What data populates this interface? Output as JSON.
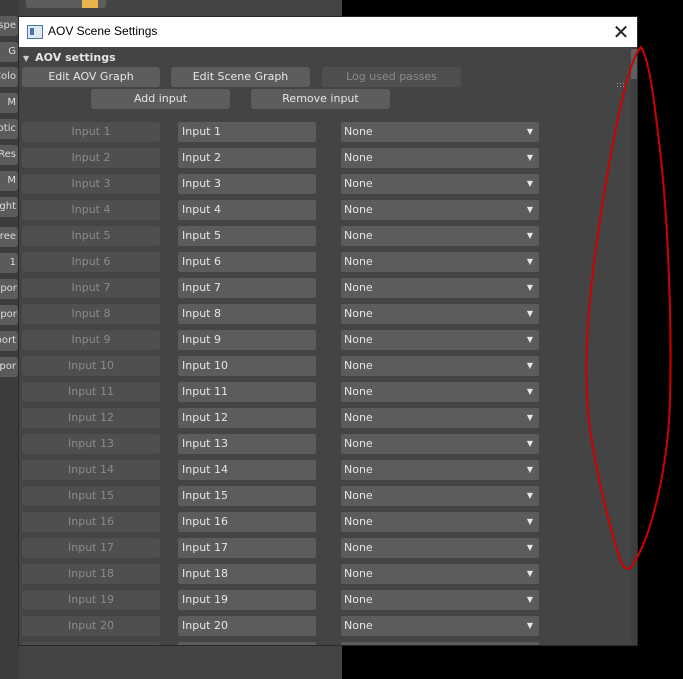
{
  "window": {
    "title": "AOV Scene Settings",
    "close_icon": "close-icon"
  },
  "background": {
    "strip_labels": [
      "rspe",
      "G",
      "Colo",
      "M",
      "otic",
      "Res",
      "M",
      "ight",
      "ree",
      "1",
      "npor",
      "npor",
      "port",
      "por"
    ]
  },
  "section": {
    "title": "AOV settings"
  },
  "toolbar": {
    "edit_aov_graph": "Edit AOV Graph",
    "edit_scene_graph": "Edit Scene Graph",
    "log_used_passes": "Log used passes",
    "add_input": "Add input",
    "remove_input": "Remove input"
  },
  "inputs": [
    {
      "label": "Input 1",
      "name": "Input 1",
      "value": "None"
    },
    {
      "label": "Input 2",
      "name": "Input 2",
      "value": "None"
    },
    {
      "label": "Input 3",
      "name": "Input 3",
      "value": "None"
    },
    {
      "label": "Input 4",
      "name": "Input 4",
      "value": "None"
    },
    {
      "label": "Input 5",
      "name": "Input 5",
      "value": "None"
    },
    {
      "label": "Input 6",
      "name": "Input 6",
      "value": "None"
    },
    {
      "label": "Input 7",
      "name": "Input 7",
      "value": "None"
    },
    {
      "label": "Input 8",
      "name": "Input 8",
      "value": "None"
    },
    {
      "label": "Input 9",
      "name": "Input 9",
      "value": "None"
    },
    {
      "label": "Input 10",
      "name": "Input 10",
      "value": "None"
    },
    {
      "label": "Input 11",
      "name": "Input 11",
      "value": "None"
    },
    {
      "label": "Input 12",
      "name": "Input 12",
      "value": "None"
    },
    {
      "label": "Input 13",
      "name": "Input 13",
      "value": "None"
    },
    {
      "label": "Input 14",
      "name": "Input 14",
      "value": "None"
    },
    {
      "label": "Input 15",
      "name": "Input 15",
      "value": "None"
    },
    {
      "label": "Input 16",
      "name": "Input 16",
      "value": "None"
    },
    {
      "label": "Input 17",
      "name": "Input 17",
      "value": "None"
    },
    {
      "label": "Input 18",
      "name": "Input 18",
      "value": "None"
    },
    {
      "label": "Input 19",
      "name": "Input 19",
      "value": "None"
    },
    {
      "label": "Input 20",
      "name": "Input 20",
      "value": "None"
    },
    {
      "label": "",
      "name": "",
      "value": "None"
    }
  ],
  "colors": {
    "annotation": "#d10000",
    "panel": "#444444",
    "button": "#5d5d5d"
  }
}
